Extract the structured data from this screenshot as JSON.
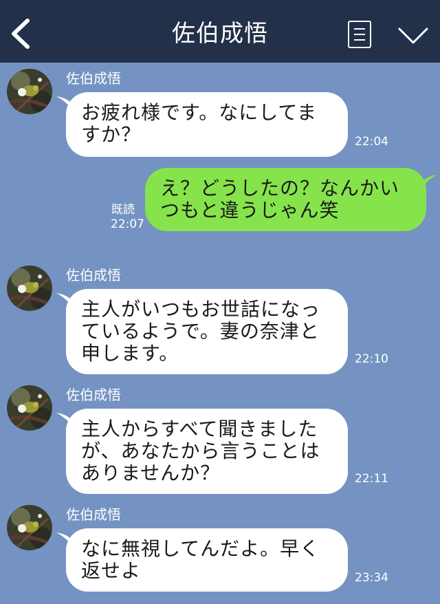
{
  "header": {
    "title": "佐伯成悟"
  },
  "messages": [
    {
      "sender": "佐伯成悟",
      "text": "お疲れ様です。なにしてま\nすか？",
      "time": "22:04"
    },
    {
      "text": "え？どうしたの？なんかい\nつもと違うじゃん笑",
      "read": "既読",
      "time": "22:07"
    },
    {
      "sender": "佐伯成悟",
      "text": "主人がいつもお世話になっ\nているようで。妻の奈津と\n申します。",
      "time": "22:10"
    },
    {
      "sender": "佐伯成悟",
      "text": "主人からすべて聞きました\nが、あなたから言うことは\nありませんか？",
      "time": "22:11"
    },
    {
      "sender": "佐伯成悟",
      "text": "なに無視してんだよ。早く\n返せよ",
      "time": "23:34"
    }
  ],
  "colors": {
    "header_bg": "#223049",
    "chat_bg": "#7493c2",
    "incoming_bubble": "#ffffff",
    "outgoing_bubble": "#86e34c"
  },
  "icons": [
    "chevron-left-icon",
    "note-icon",
    "chevron-down-icon",
    "avatar-image"
  ]
}
